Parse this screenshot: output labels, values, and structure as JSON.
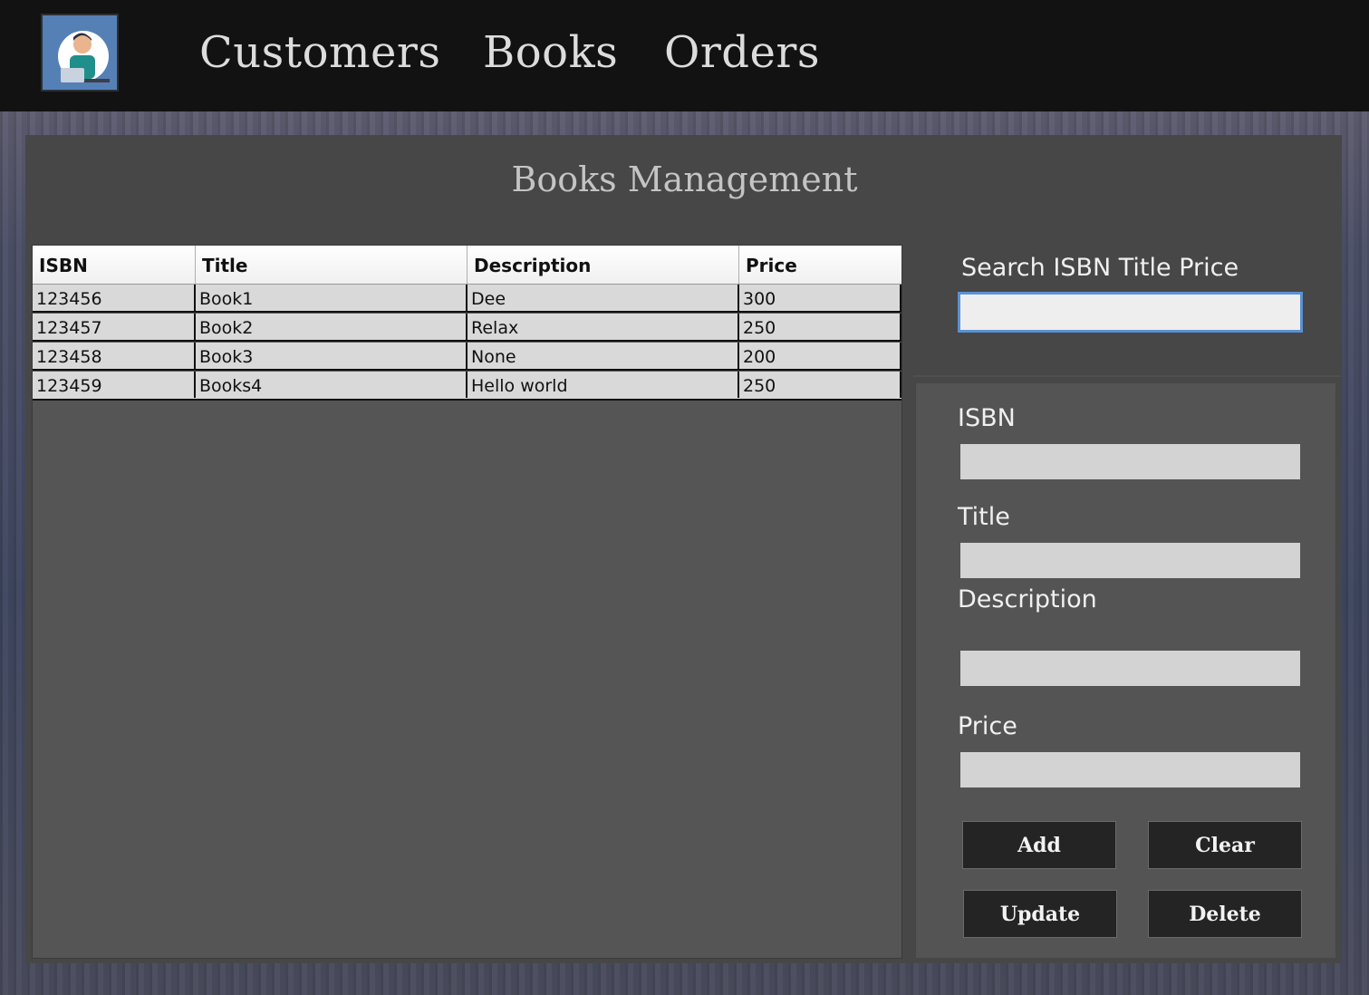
{
  "nav": {
    "logo": "user-at-laptop-logo",
    "links": [
      "Customers",
      "Books",
      "Orders"
    ]
  },
  "page": {
    "title": "Books Management"
  },
  "table": {
    "headers": [
      "ISBN",
      "Title",
      "Description",
      "Price"
    ],
    "rows": [
      [
        "123456",
        "Book1",
        "Dee",
        "300"
      ],
      [
        "123457",
        "Book2",
        "Relax",
        "250"
      ],
      [
        "123458",
        "Book3",
        "None",
        "200"
      ],
      [
        "123459",
        "Books4",
        "Hello world",
        "250"
      ]
    ]
  },
  "search": {
    "label": "Search ISBN Title Price",
    "value": ""
  },
  "form": {
    "isbn_label": "ISBN",
    "title_label": "Title",
    "description_label": "Description",
    "price_label": "Price"
  },
  "buttons": {
    "add": "Add",
    "clear": "Clear",
    "update": "Update",
    "delete": "Delete"
  },
  "colors": {
    "topbar": "#121212",
    "panel": "#474747",
    "grid": "#555555",
    "search_border": "#5b91d2"
  }
}
